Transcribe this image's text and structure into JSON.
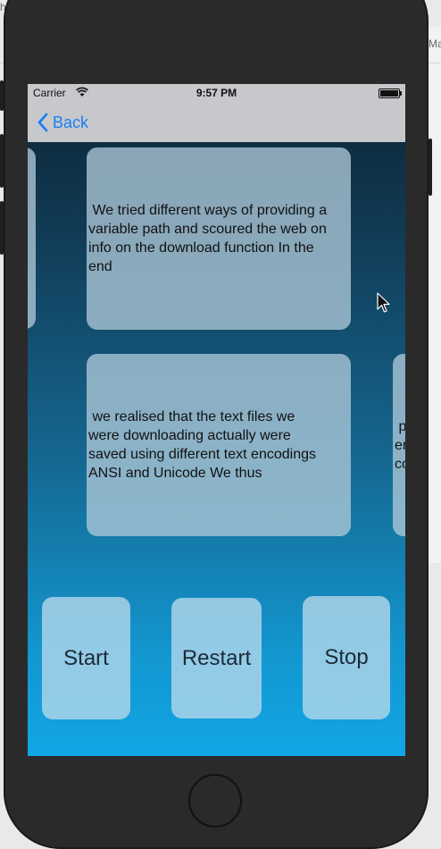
{
  "desktop": {
    "left_fragment": "hon",
    "right_fragment": "Ma"
  },
  "status_bar": {
    "carrier": "Carrier",
    "time": "9:57 PM"
  },
  "nav_bar": {
    "back_label": "Back"
  },
  "cards": [
    {
      "text": " We tried different ways of providing a\nvariable path and scoured the web on\ninfo on the download function In the\nend"
    },
    {
      "text": " we realised that the text files we\nwere downloading actually were\nsaved using different text encodings\nANSI and Unicode We thus"
    },
    {
      "text": " p\ner\nco"
    }
  ],
  "controls": {
    "start_label": "Start",
    "restart_label": "Restart",
    "stop_label": "Stop"
  },
  "icons": [
    "wifi-icon",
    "battery-icon",
    "back-chevron-icon",
    "mouse-cursor-icon"
  ]
}
